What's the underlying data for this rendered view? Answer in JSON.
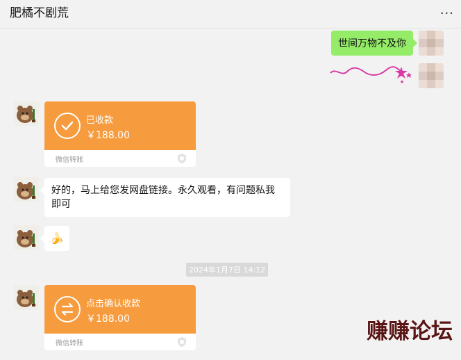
{
  "header": {
    "title": "肥橘不剧荒",
    "more_label": "..."
  },
  "messages": {
    "outgoing_text": "世间万物不及你",
    "incoming_text": "好的，马上给您发网盘链接。永久观看，有问题私我即可",
    "banana_emoji": "🍌"
  },
  "transfers": [
    {
      "status": "已收款",
      "amount": "￥188.00",
      "label": "微信转账"
    },
    {
      "status": "点击确认收款",
      "amount": "￥188.00",
      "label": "微信转账"
    }
  ],
  "timestamp": "2024年1月7日 14:12",
  "watermark": "赚赚论坛",
  "colors": {
    "orange": "#f79c3e",
    "green": "#95ec69",
    "background": "#f2f2f2"
  }
}
